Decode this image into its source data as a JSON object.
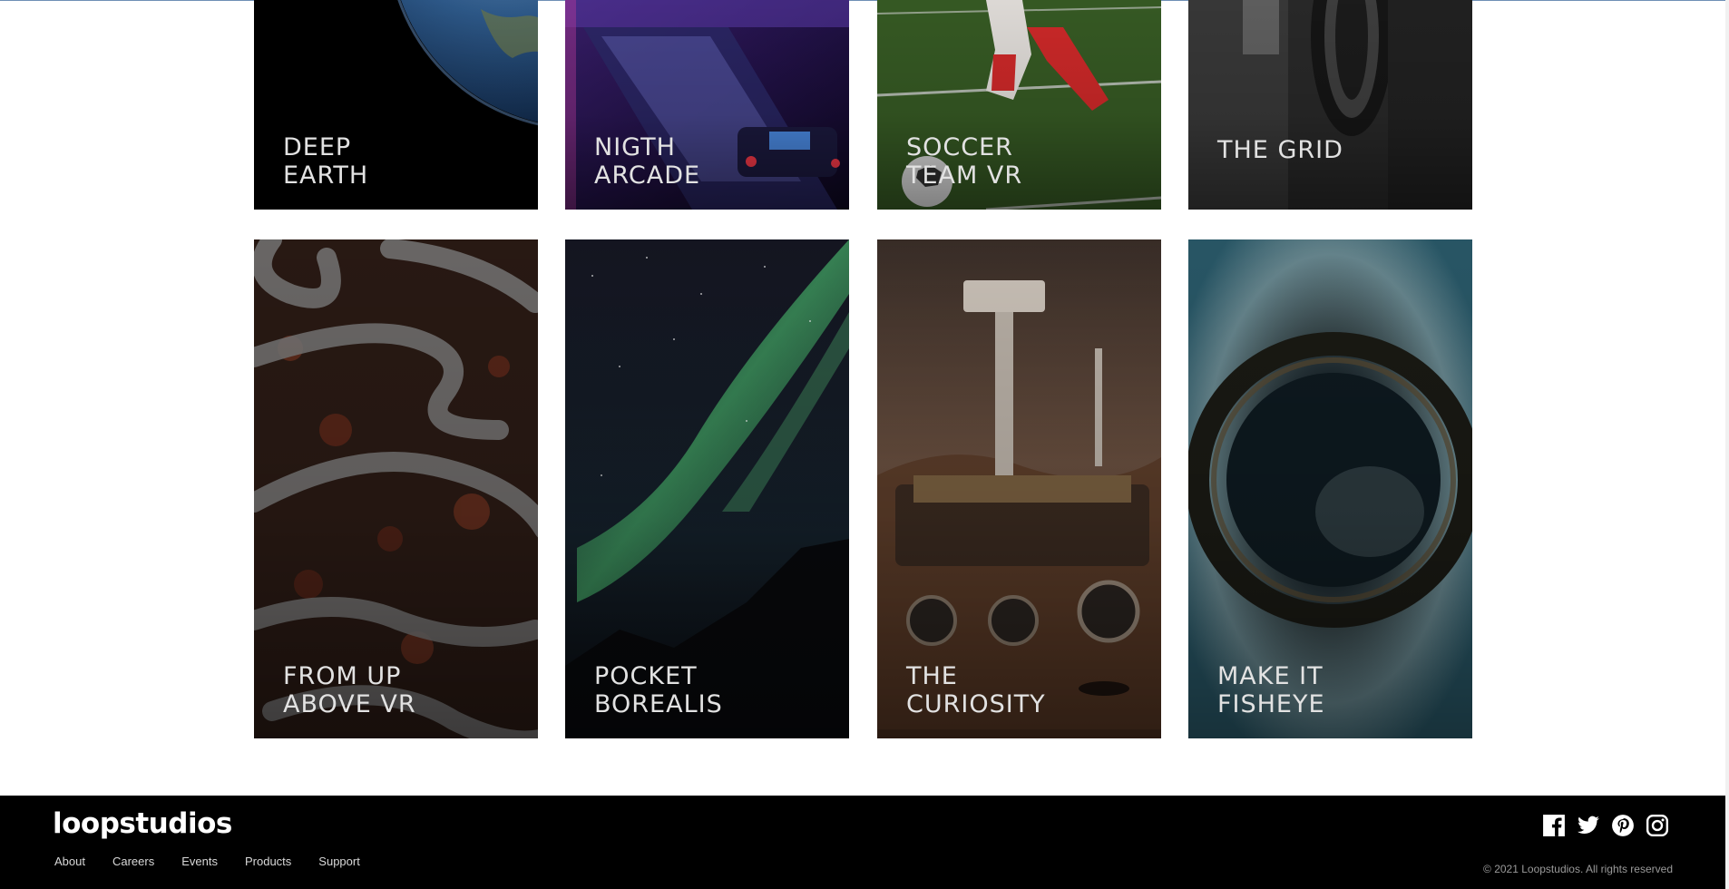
{
  "cards": [
    {
      "title": [
        "DEEP",
        "EARTH"
      ]
    },
    {
      "title": [
        "NIGTH",
        "ARCADE"
      ]
    },
    {
      "title": [
        "SOCCER",
        "TEAM VR"
      ]
    },
    {
      "title": [
        "THE GRID"
      ]
    },
    {
      "title": [
        "FROM UP",
        "ABOVE VR"
      ]
    },
    {
      "title": [
        "POCKET",
        "BOREALIS"
      ]
    },
    {
      "title": [
        "THE",
        "CURIOSITY"
      ]
    },
    {
      "title": [
        "MAKE IT",
        "FISHEYE"
      ]
    }
  ],
  "footer": {
    "logo": "loopstudios",
    "nav": [
      "About",
      "Careers",
      "Events",
      "Products",
      "Support"
    ],
    "social_icons": [
      "facebook-icon",
      "twitter-icon",
      "pinterest-icon",
      "instagram-icon"
    ],
    "copyright": "© 2021 Loopstudios. All rights reserved"
  }
}
